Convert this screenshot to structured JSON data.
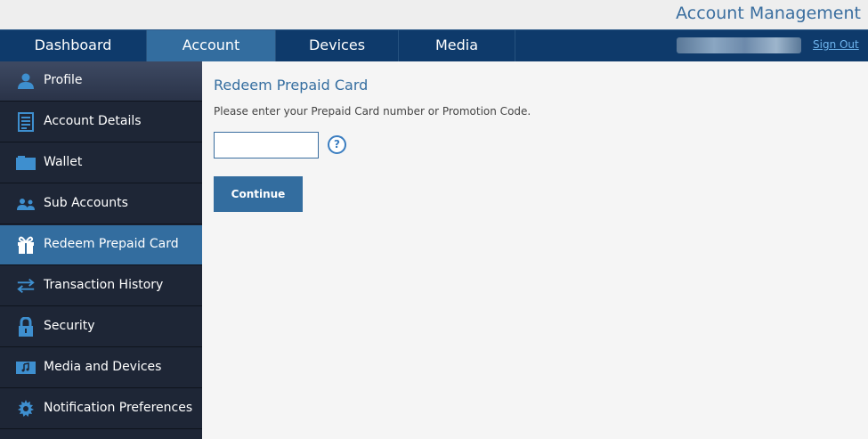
{
  "header": {
    "title": "Account Management"
  },
  "nav": {
    "tabs": [
      {
        "label": "Dashboard",
        "active": false
      },
      {
        "label": "Account",
        "active": true
      },
      {
        "label": "Devices",
        "active": false
      },
      {
        "label": "Media",
        "active": false
      }
    ],
    "signout_label": "Sign Out",
    "user_name_redacted": true
  },
  "sidebar": {
    "items": [
      {
        "label": "Profile",
        "icon": "user-icon",
        "active": false
      },
      {
        "label": "Account Details",
        "icon": "document-icon",
        "active": false
      },
      {
        "label": "Wallet",
        "icon": "wallet-icon",
        "active": false
      },
      {
        "label": "Sub Accounts",
        "icon": "users-icon",
        "active": false
      },
      {
        "label": "Redeem Prepaid Card",
        "icon": "gift-icon",
        "active": true
      },
      {
        "label": "Transaction History",
        "icon": "transfer-arrows-icon",
        "active": false
      },
      {
        "label": "Security",
        "icon": "lock-icon",
        "active": false
      },
      {
        "label": "Media and Devices",
        "icon": "media-icon",
        "active": false
      },
      {
        "label": "Notification Preferences",
        "icon": "gear-icon",
        "active": false
      }
    ]
  },
  "main": {
    "title": "Redeem Prepaid Card",
    "instruction": "Please enter your Prepaid Card number or Promotion Code.",
    "code_input": {
      "value": "",
      "placeholder": ""
    },
    "help_label": "?",
    "continue_label": "Continue"
  },
  "colors": {
    "nav_bg": "#0e3a6b",
    "accent": "#336d9f",
    "sidebar_bg": "#1e2636",
    "title_text": "#3a6e9f"
  }
}
